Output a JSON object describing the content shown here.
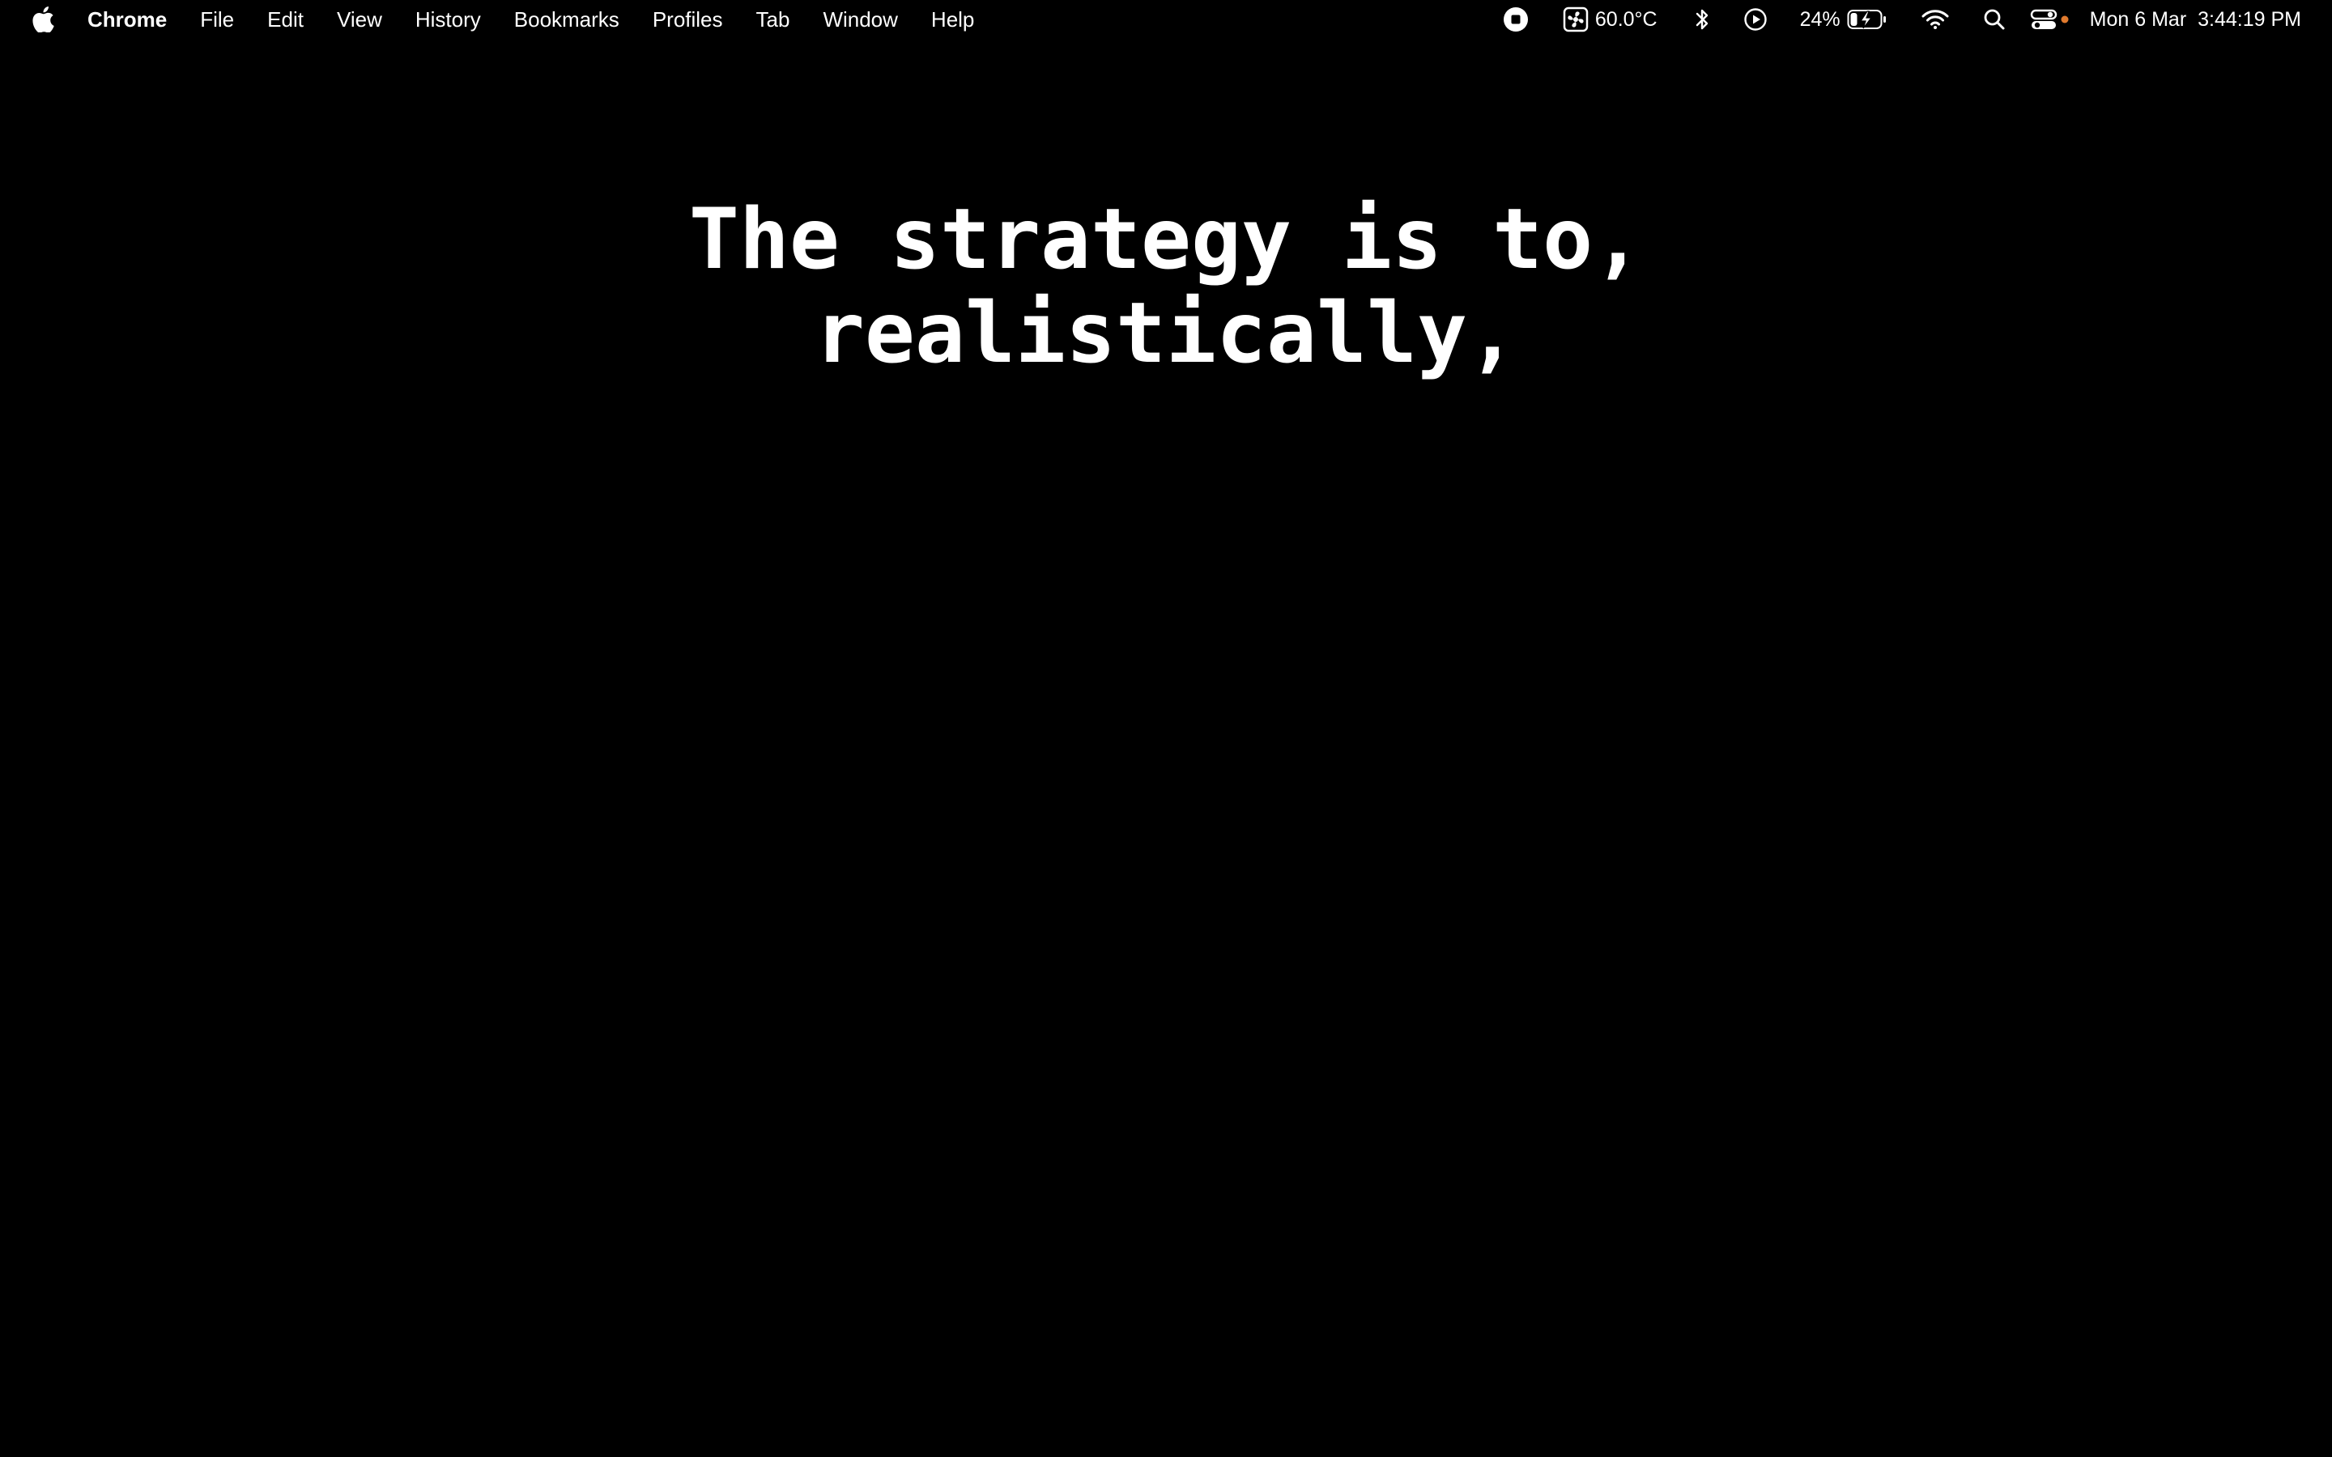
{
  "menubar": {
    "apple_icon": "apple-icon",
    "app_name": "Chrome",
    "menus": [
      "File",
      "Edit",
      "View",
      "History",
      "Bookmarks",
      "Profiles",
      "Tab",
      "Window",
      "Help"
    ],
    "status": {
      "record_icon": "screen-record-stop-icon",
      "fan_icon": "fan-temperature-icon",
      "temperature": "60.0°C",
      "bluetooth_icon": "bluetooth-icon",
      "media_icon": "play-circle-icon",
      "battery_percent": "24%",
      "battery_icon": "battery-charging-icon",
      "wifi_icon": "wifi-icon",
      "search_icon": "spotlight-search-icon",
      "control_center_icon": "control-center-icon",
      "date": "Mon 6 Mar",
      "time": "3:44:19 PM"
    }
  },
  "content": {
    "line1": "The strategy is to,",
    "line2": "realistically,"
  },
  "colors": {
    "background": "#000000",
    "text": "#ffffff",
    "indicator_dot": "#e07a2e"
  }
}
